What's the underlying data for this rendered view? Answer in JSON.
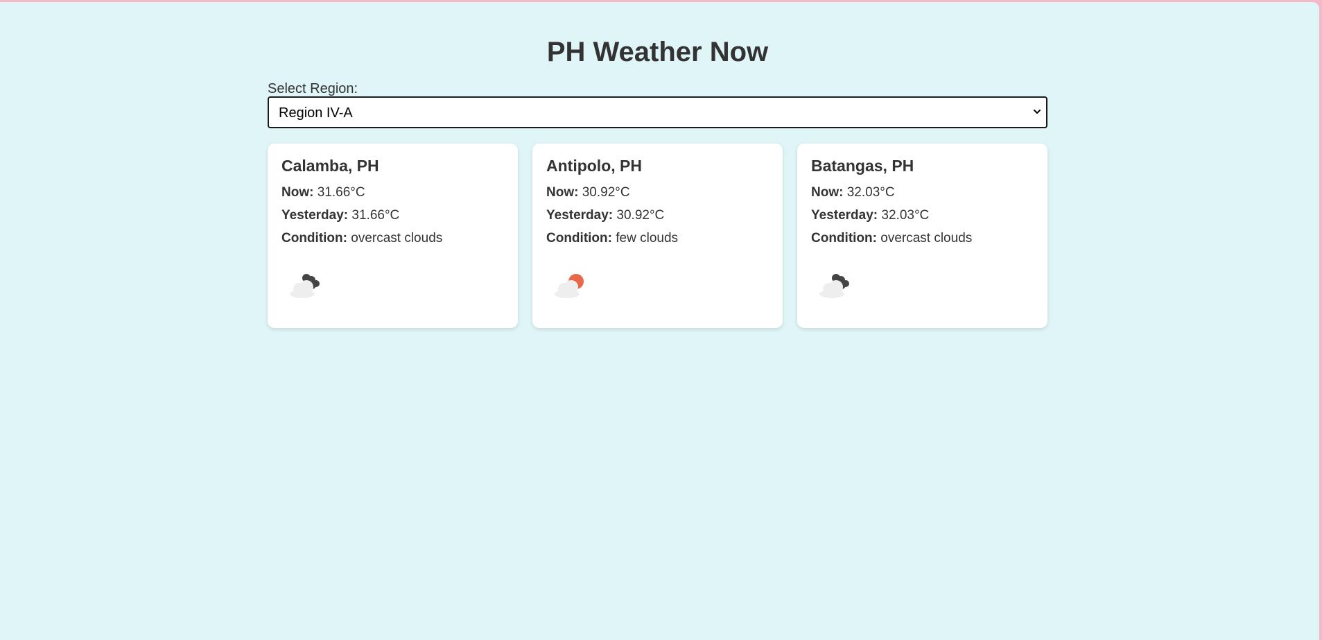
{
  "header": {
    "title": "PH Weather Now"
  },
  "region_select": {
    "label": "Select Region:",
    "selected": "Region IV-A"
  },
  "labels": {
    "now": "Now:",
    "yesterday": "Yesterday:",
    "condition": "Condition:"
  },
  "cards": [
    {
      "city": "Calamba, PH",
      "now": "31.66°C",
      "yesterday": "31.66°C",
      "condition": "overcast clouds",
      "icon": "overcast-clouds-icon"
    },
    {
      "city": "Antipolo, PH",
      "now": "30.92°C",
      "yesterday": "30.92°C",
      "condition": "few clouds",
      "icon": "few-clouds-icon"
    },
    {
      "city": "Batangas, PH",
      "now": "32.03°C",
      "yesterday": "32.03°C",
      "condition": "overcast clouds",
      "icon": "overcast-clouds-icon"
    }
  ],
  "colors": {
    "background": "#dff5f8",
    "text": "#333333",
    "card": "#ffffff",
    "sun": "#e8694a",
    "dark_cloud": "#444444",
    "light_cloud": "#eeeeee"
  }
}
